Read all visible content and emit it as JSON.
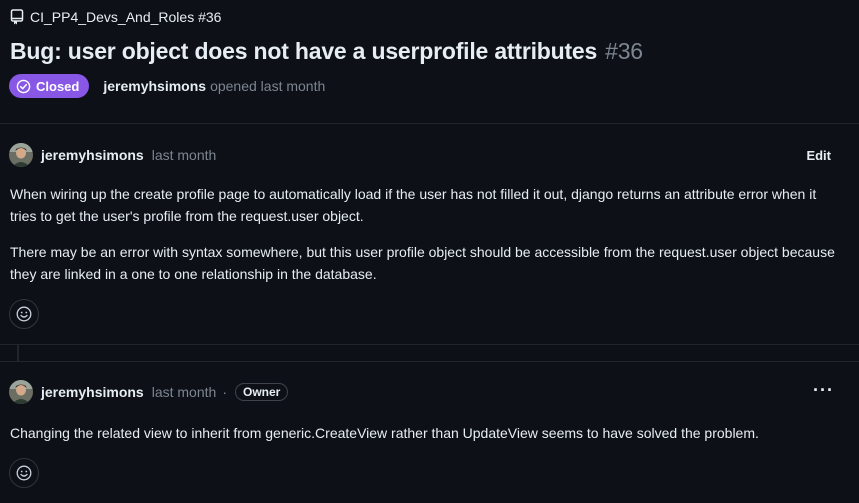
{
  "repo": {
    "label": "CI_PP4_Devs_And_Roles #36"
  },
  "issue": {
    "title": "Bug: user object does not have a userprofile attributes",
    "number": "#36",
    "state": "Closed",
    "author": "jeremyhsimons",
    "opened_text": "opened last month"
  },
  "comments": [
    {
      "author": "jeremyhsimons",
      "time": "last month",
      "edit_label": "Edit",
      "paragraphs": [
        "When wiring up the create profile page to automatically load if the user has not filled it out, django returns an attribute error when it tries to get the user's profile from the request.user object.",
        "There may be an error with syntax somewhere, but this user profile object should be accessible from the request.user object because they are linked in a one to one relationship in the database."
      ]
    },
    {
      "author": "jeremyhsimons",
      "time": "last month",
      "separator": "·",
      "role_badge": "Owner",
      "more_label": "···",
      "paragraphs": [
        "Changing the related view to inherit from generic.CreateView rather than UpdateView seems to have solved the problem."
      ]
    }
  ],
  "colors": {
    "background": "#0d1117",
    "closed_badge": "#8957e5",
    "muted_text": "#7d8590",
    "border": "#30363d"
  },
  "icons": {
    "repo": "repo-icon",
    "closed": "check-circle-icon",
    "reaction": "smiley-icon",
    "avatar": "user-avatar"
  }
}
